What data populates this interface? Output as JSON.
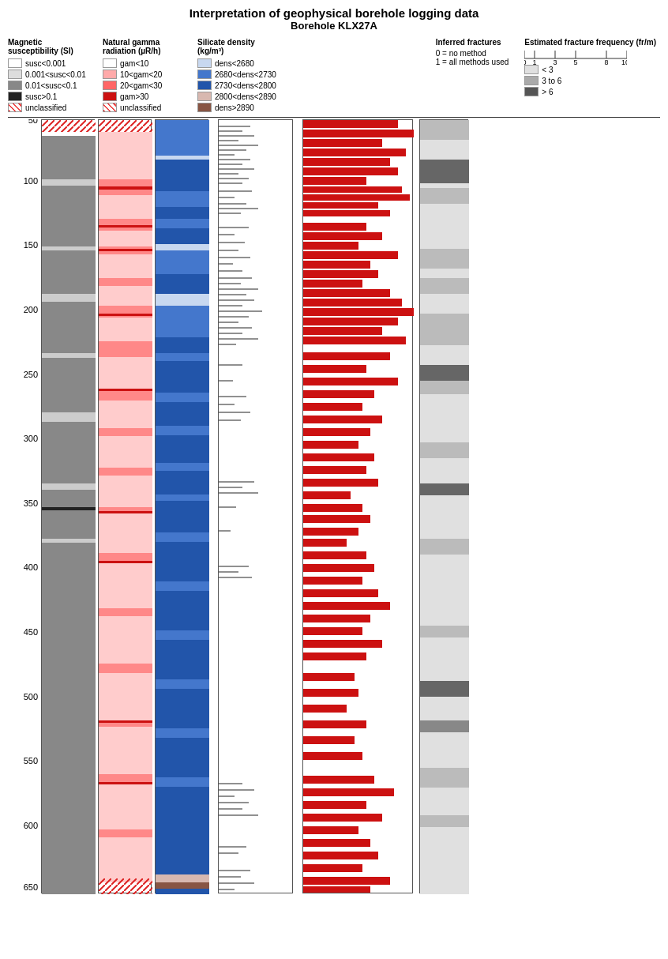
{
  "title": "Interpretation of geophysical borehole logging data",
  "subtitle": "Borehole KLX27A",
  "legend": {
    "mag_title": "Magnetic\nsusceptibility (SI)",
    "mag_items": [
      {
        "label": "susc<0.001",
        "color": "#fff"
      },
      {
        "label": "0.001<susc<0.01",
        "color": "#ddd"
      },
      {
        "label": "0.01<susc<0.1",
        "color": "#888"
      },
      {
        "label": "susc>0.1",
        "color": "#222"
      },
      {
        "label": "unclassified",
        "hatched": true
      }
    ],
    "gamma_title": "Natural gamma\nradiation (µR/h)",
    "gamma_items": [
      {
        "label": "gam<10",
        "color": "#fff"
      },
      {
        "label": "10<gam<20",
        "color": "#ffaaaa"
      },
      {
        "label": "20<gam<30",
        "color": "#ff7777"
      },
      {
        "label": "gam>30",
        "color": "#dd2222"
      },
      {
        "label": "unclassified",
        "hatched": true
      }
    ],
    "density_title": "Silicate density\n(kg/m³)",
    "density_items": [
      {
        "label": "dens<2680",
        "color": "#c8d8f0"
      },
      {
        "label": "2680<dens<2730",
        "color": "#4477cc"
      },
      {
        "label": "2730<dens<2800",
        "color": "#2255aa"
      },
      {
        "label": "2800<dens<2890",
        "color": "#d8b8b0"
      },
      {
        "label": "dens>2890",
        "color": "#885544"
      }
    ],
    "fractures_title": "Inferred fractures",
    "fractures_note1": "0 = no method",
    "fractures_note2": "1 = all methods used",
    "freq_title": "Estimated fracture frequency (fr/m)",
    "freq_items": [
      {
        "label": "< 3",
        "color": "#e0e0e0"
      },
      {
        "label": "3 to 6",
        "color": "#aaaaaa"
      },
      {
        "label": "> 6",
        "color": "#555555"
      }
    ]
  },
  "depth_start": 50,
  "depth_end": 650,
  "depth_labels": [
    50,
    100,
    150,
    200,
    250,
    300,
    350,
    400,
    450,
    500,
    550,
    600,
    650
  ],
  "scale_labels": [
    "0",
    "1",
    "3",
    "5",
    "8",
    "10"
  ]
}
